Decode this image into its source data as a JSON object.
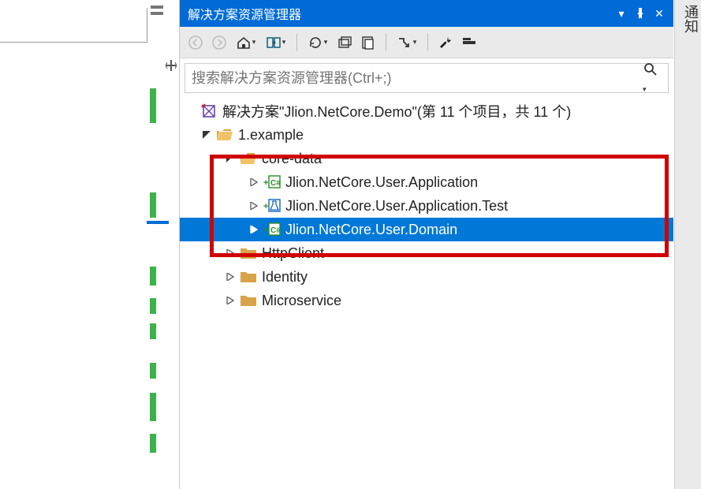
{
  "panel_title": "解决方案资源管理器",
  "right_strip": "通知",
  "search": {
    "placeholder": "搜索解决方案资源管理器(Ctrl+;)"
  },
  "tree": {
    "solution": "解决方案\"Jlion.NetCore.Demo\"(第 11 个项目，共 11 个)",
    "example": "1.example",
    "core_data": "core-data",
    "app": "Jlion.NetCore.User.Application",
    "app_test": "Jlion.NetCore.User.Application.Test",
    "domain": "Jlion.NetCore.User.Domain",
    "httpclient": "HttpClient",
    "identity": "Identity",
    "microservice": "Microservice"
  }
}
